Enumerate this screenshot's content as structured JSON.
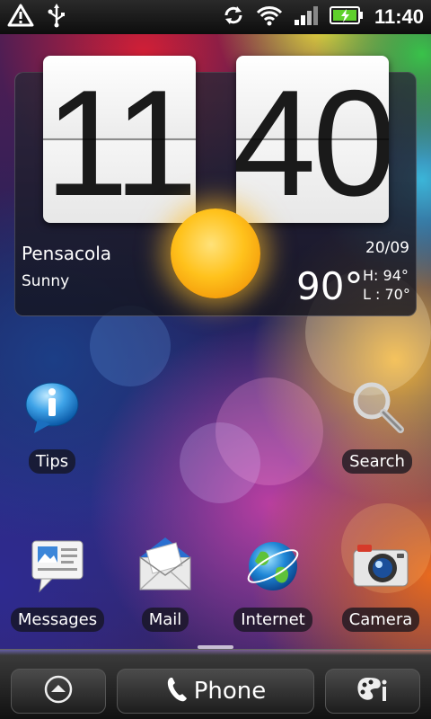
{
  "status_bar": {
    "time": "11:40",
    "left_icons": [
      "warning-icon",
      "usb-icon"
    ],
    "right_icons": [
      "sync-icon",
      "wifi-icon",
      "signal-icon",
      "battery-charging-icon"
    ]
  },
  "clock_widget": {
    "hours": "11",
    "minutes": "40",
    "city": "Pensacola",
    "condition": "Sunny",
    "date": "20/09",
    "temperature": "90°",
    "high": "H: 94°",
    "low": "L : 70°",
    "weather_icon": "sun-icon"
  },
  "apps": {
    "tips": {
      "label": "Tips",
      "icon": "info-bubble-icon"
    },
    "search": {
      "label": "Search",
      "icon": "magnifier-icon"
    },
    "messages": {
      "label": "Messages",
      "icon": "message-icon"
    },
    "mail": {
      "label": "Mail",
      "icon": "envelope-icon"
    },
    "internet": {
      "label": "Internet",
      "icon": "globe-icon"
    },
    "camera": {
      "label": "Camera",
      "icon": "camera-icon"
    }
  },
  "dock": {
    "phone_label": "Phone",
    "left_icon": "up-arrow-icon",
    "right_icon": "personalize-icon"
  },
  "colors": {
    "status_bar": "#0d0d0d",
    "widget_bg": "#1c1c28",
    "label_bg": "#14141e",
    "battery_green": "#5fd12c"
  }
}
